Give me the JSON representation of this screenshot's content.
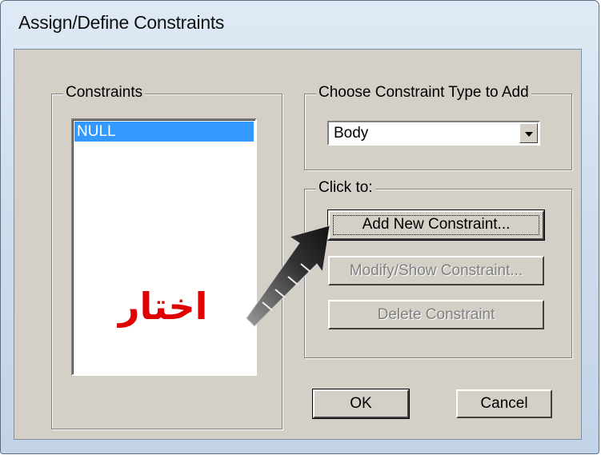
{
  "window": {
    "title": "Assign/Define Constraints"
  },
  "constraints_group": {
    "label": "Constraints",
    "items": [
      "NULL"
    ]
  },
  "type_group": {
    "label": "Choose Constraint Type to Add",
    "selected": "Body"
  },
  "actions_group": {
    "label": "Click to:",
    "add_label": "Add New Constraint...",
    "modify_label": "Modify/Show Constraint...",
    "delete_label": "Delete Constraint"
  },
  "footer": {
    "ok_label": "OK",
    "cancel_label": "Cancel"
  },
  "annotation": {
    "text": "اختار",
    "color": "#e00000"
  },
  "icons": {
    "combo_arrow": "chevron-down-icon",
    "pointer": "arrow-pointer-icon"
  }
}
